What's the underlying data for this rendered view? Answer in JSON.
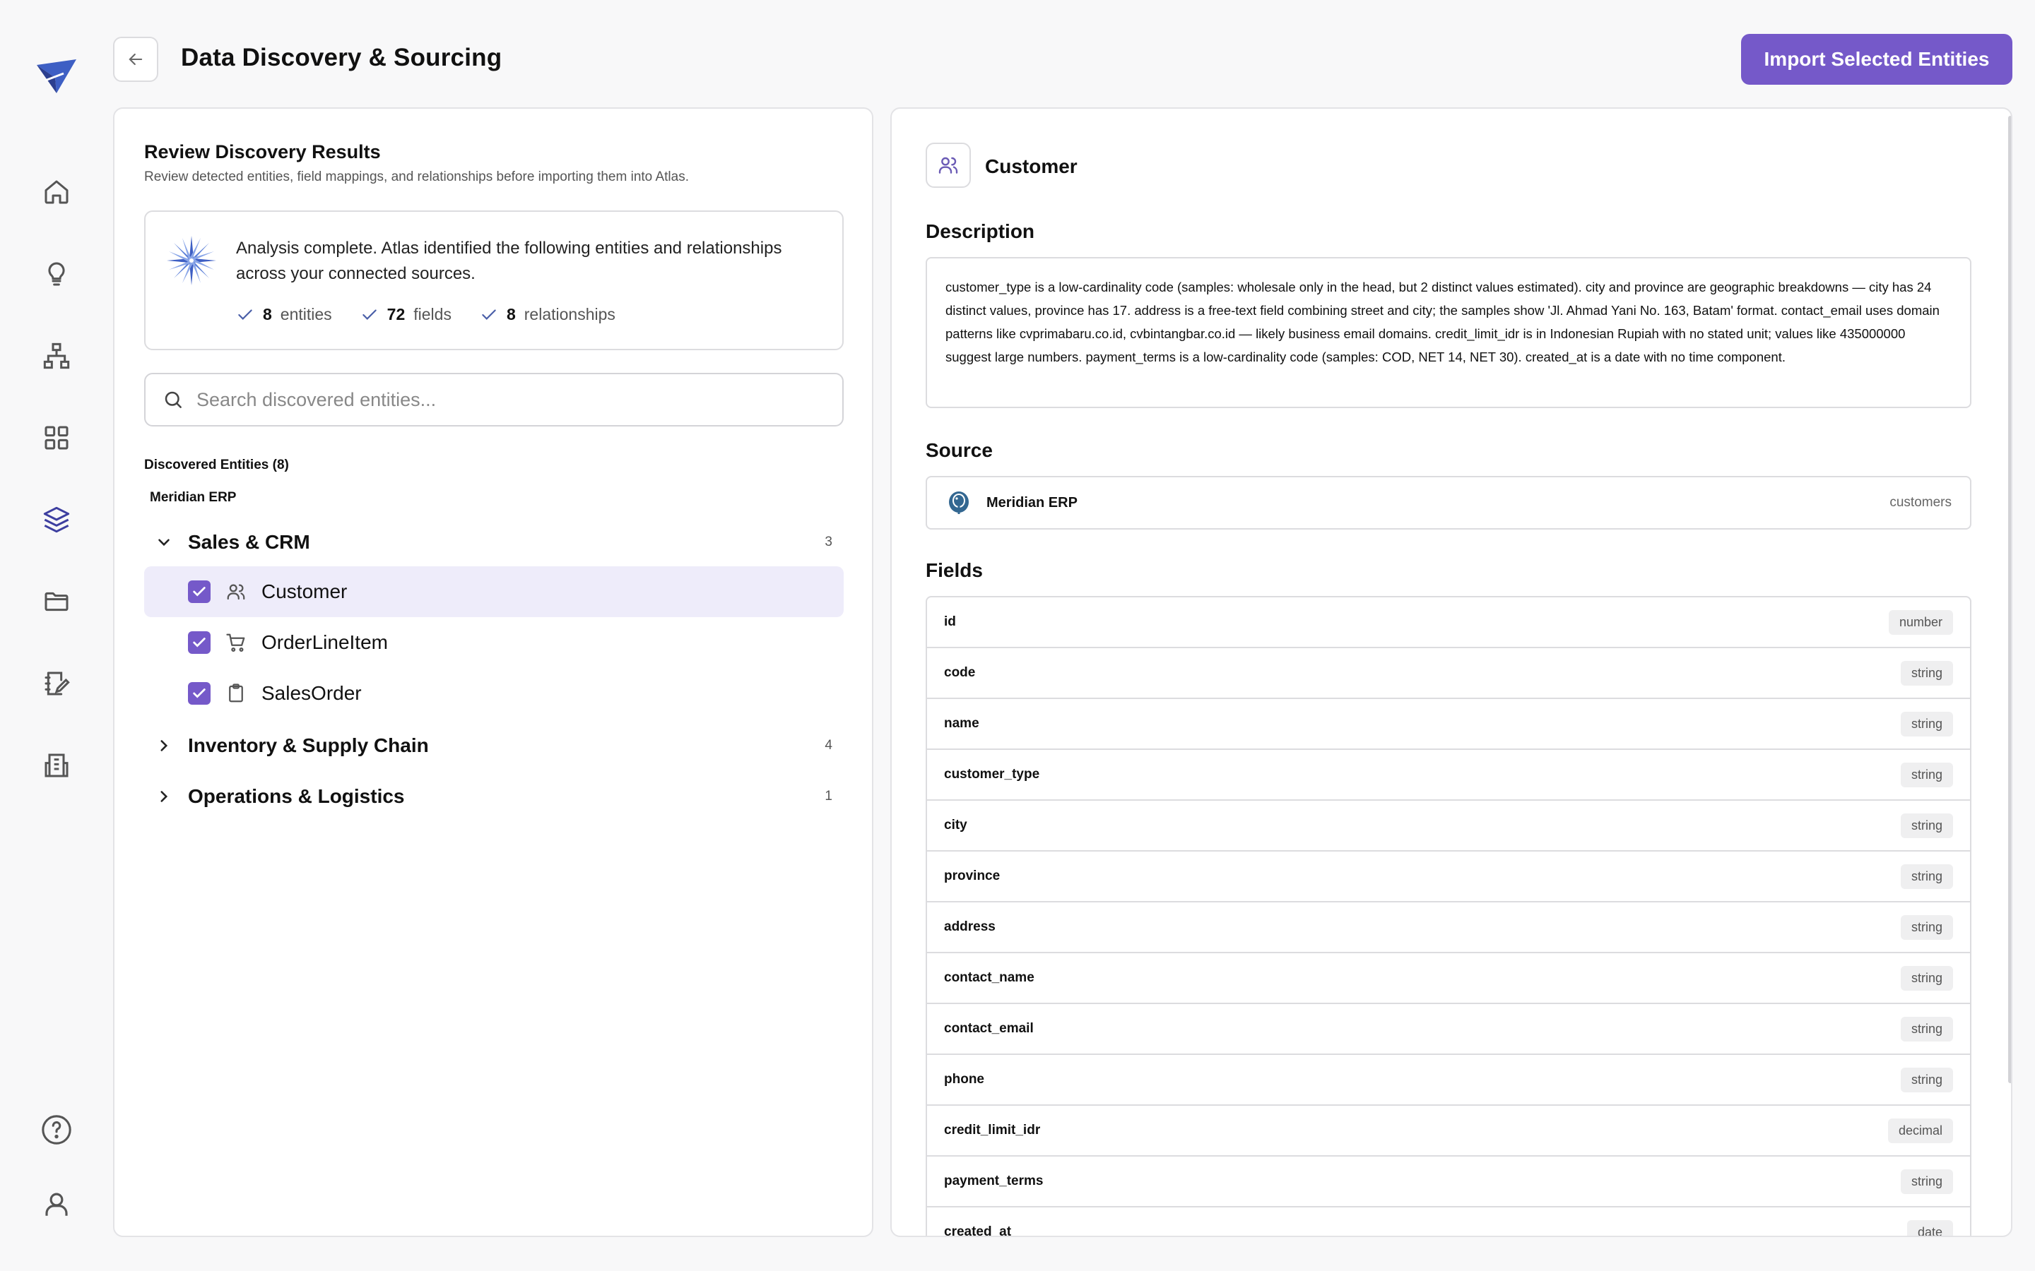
{
  "header": {
    "title": "Data Discovery & Sourcing",
    "import_label": "Import Selected Entities"
  },
  "rail": {
    "icons": [
      "logo-icon",
      "home-icon",
      "lightbulb-icon",
      "hierarchy-icon",
      "grid-icon",
      "layers-icon",
      "folder-icon",
      "notes-icon",
      "building-icon",
      "help-icon",
      "user-icon"
    ],
    "active": "layers-icon"
  },
  "left": {
    "title": "Review Discovery Results",
    "subtitle": "Review detected entities, field mappings, and relationships before importing them into Atlas.",
    "analysis": {
      "message": "Analysis complete. Atlas identified the following entities and relationships across your connected sources.",
      "stats": [
        {
          "count": "8",
          "label": "entities"
        },
        {
          "count": "72",
          "label": "fields"
        },
        {
          "count": "8",
          "label": "relationships"
        }
      ]
    },
    "search_placeholder": "Search discovered entities...",
    "discovered_label": "Discovered Entities (8)",
    "source_name": "Meridian ERP",
    "groups": [
      {
        "name": "Sales & CRM",
        "count": "3",
        "expanded": true,
        "entities": [
          {
            "name": "Customer",
            "icon": "users-icon",
            "checked": true,
            "selected": true
          },
          {
            "name": "OrderLineItem",
            "icon": "cart-icon",
            "checked": true,
            "selected": false
          },
          {
            "name": "SalesOrder",
            "icon": "clipboard-icon",
            "checked": true,
            "selected": false
          }
        ]
      },
      {
        "name": "Inventory & Supply Chain",
        "count": "4",
        "expanded": false,
        "entities": []
      },
      {
        "name": "Operations & Logistics",
        "count": "1",
        "expanded": false,
        "entities": []
      }
    ]
  },
  "detail": {
    "title": "Customer",
    "description_heading": "Description",
    "description": "customer_type is a low-cardinality code (samples: wholesale only in the head, but 2 distinct values estimated). city and province are geographic breakdowns — city has 24 distinct values, province has 17. address is a free-text field combining street and city; the samples show 'Jl. Ahmad Yani No. 163, Batam' format. contact_email uses domain patterns like cvprimabaru.co.id, cvbintangbar.co.id — likely business email domains. credit_limit_idr is in Indonesian Rupiah with no stated unit; values like 435000000 suggest large numbers. payment_terms is a low-cardinality code (samples: COD, NET 14, NET 30). created_at is a date with no time component.",
    "source_heading": "Source",
    "source": {
      "name": "Meridian ERP",
      "table": "customers",
      "icon": "postgres-icon"
    },
    "fields_heading": "Fields",
    "fields": [
      {
        "name": "id",
        "type": "number"
      },
      {
        "name": "code",
        "type": "string"
      },
      {
        "name": "name",
        "type": "string"
      },
      {
        "name": "customer_type",
        "type": "string"
      },
      {
        "name": "city",
        "type": "string"
      },
      {
        "name": "province",
        "type": "string"
      },
      {
        "name": "address",
        "type": "string"
      },
      {
        "name": "contact_name",
        "type": "string"
      },
      {
        "name": "contact_email",
        "type": "string"
      },
      {
        "name": "phone",
        "type": "string"
      },
      {
        "name": "credit_limit_idr",
        "type": "decimal"
      },
      {
        "name": "payment_terms",
        "type": "string"
      },
      {
        "name": "created_at",
        "type": "date"
      }
    ]
  },
  "colors": {
    "accent": "#7559c9",
    "selected_bg": "#eeecfa",
    "active_nav": "#3d3fa0"
  }
}
